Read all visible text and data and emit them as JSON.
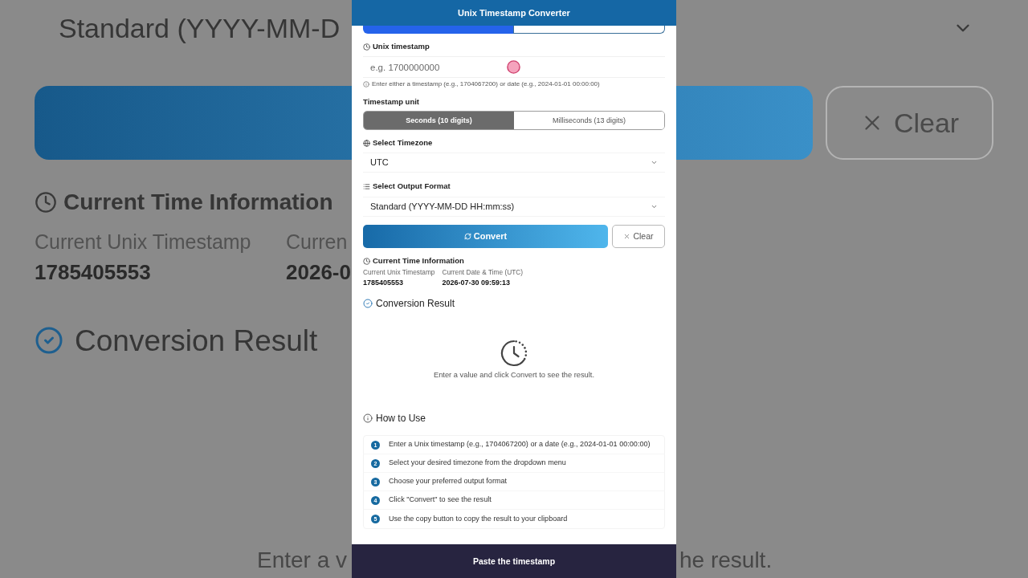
{
  "backdrop": {
    "format_value": "Standard (YYYY-MM-D",
    "clear_button": "Clear",
    "current_time_heading": "Current Time Information",
    "current_unix_label": "Current Unix Timestamp",
    "current_date_label": "Curren",
    "current_unix_value": "1785405553",
    "current_date_value": "2026-0",
    "result_heading": "Conversion Result",
    "empty_message_left": "Enter a v",
    "empty_message_right": "he result."
  },
  "header": {
    "title": "Unix Timestamp Converter"
  },
  "mode_tabs": [
    {
      "selected": true
    },
    {
      "selected": false
    }
  ],
  "timestamp_field": {
    "label": "Unix timestamp",
    "placeholder": "e.g. 1700000000",
    "hint": "Enter either a timestamp (e.g., 1704067200) or date (e.g., 2024-01-01 00:00:00)"
  },
  "unit": {
    "label": "Timestamp unit",
    "options": [
      {
        "label": "Seconds (10 digits)",
        "selected": true
      },
      {
        "label": "Milliseconds (13 digits)",
        "selected": false
      }
    ]
  },
  "timezone": {
    "label": "Select Timezone",
    "value": "UTC"
  },
  "output_format": {
    "label": "Select Output Format",
    "value": "Standard (YYYY-MM-DD HH:mm:ss)"
  },
  "actions": [
    {
      "kind": "primary",
      "label": "Convert"
    },
    {
      "kind": "secondary",
      "label": "Clear"
    }
  ],
  "current_time": {
    "heading": "Current Time Information",
    "items": [
      {
        "label": "Current Unix Timestamp",
        "value": "1785405553"
      },
      {
        "label": "Current Date & Time (UTC)",
        "value": "2026-07-30 09:59:13"
      }
    ]
  },
  "result": {
    "heading": "Conversion Result",
    "empty_message": "Enter a value and click Convert to see the result."
  },
  "how_to_use": {
    "heading": "How to Use",
    "steps": [
      {
        "number": "1",
        "text": "Enter a Unix timestamp (e.g., 1704067200) or a date (e.g., 2024-01-01 00:00:00)"
      },
      {
        "number": "2",
        "text": "Select your desired timezone from the dropdown menu"
      },
      {
        "number": "3",
        "text": "Choose your preferred output format"
      },
      {
        "number": "4",
        "text": "Click \"Convert\" to see the result"
      },
      {
        "number": "5",
        "text": "Use the copy button to copy the result to your clipboard"
      }
    ]
  },
  "caption": "Paste the timestamp"
}
